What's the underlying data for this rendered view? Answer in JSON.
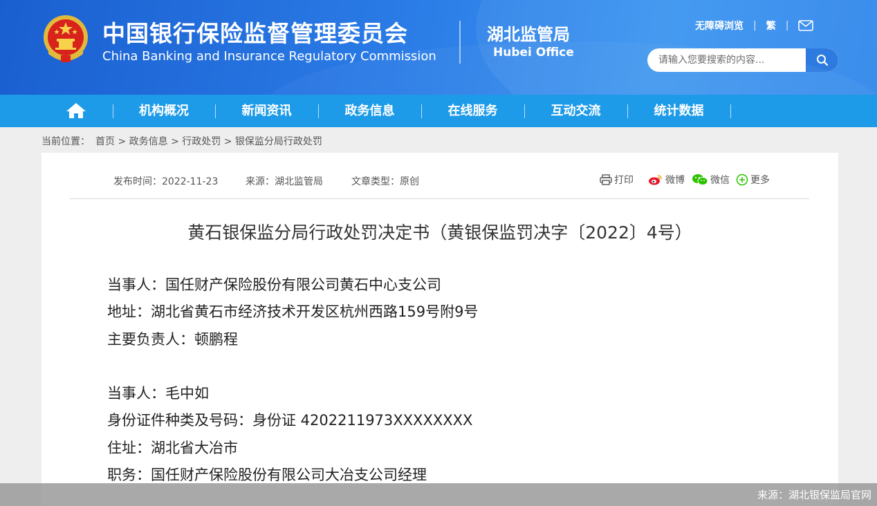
{
  "header": {
    "title_cn": "中国银行保险监督管理委员会",
    "title_en": "China Banking and Insurance Regulatory Commission",
    "office_cn": "湖北监管局",
    "office_en": "Hubei Office",
    "accessibility_link": "无障碍浏览",
    "traditional_link": "繁",
    "separator": "|",
    "search_placeholder": "请输入您要搜索的内容...",
    "colors": {
      "header_blue": "#2a7be6",
      "nav_blue": "#1e9be8",
      "search_button": "#2d7be0"
    }
  },
  "nav": {
    "home_icon": "home-icon",
    "items": [
      "机构概况",
      "新闻资讯",
      "政务信息",
      "在线服务",
      "互动交流",
      "统计数据"
    ]
  },
  "breadcrumb": {
    "label": "当前位置：",
    "items": [
      "首页",
      "政务信息",
      "行政处罚",
      "银保监分局行政处罚"
    ],
    "separator": " > "
  },
  "article": {
    "publish_time": "发布时间：2022-11-23",
    "source": "来源：湖北监管局",
    "type": "文章类型：原创",
    "share": {
      "print": "打印",
      "weibo": "微博",
      "wechat": "微信",
      "more": "更多"
    },
    "title": "黄石银保监分局行政处罚决定书（黄银保监罚决字〔2022〕4号）",
    "lines": [
      "当事人：国任财产保险股份有限公司黄石中心支公司",
      "地址：湖北省黄石市经济技术开发区杭州西路159号附9号",
      "主要负责人：顿鹏程",
      "当事人：毛中如",
      "身份证件种类及号码：身份证 4202211973XXXXXXXX",
      "住址：湖北省大冶市",
      "职务：国任财产保险股份有限公司大冶支公司经理"
    ]
  },
  "watermark": "来源：湖北银保监局官网"
}
